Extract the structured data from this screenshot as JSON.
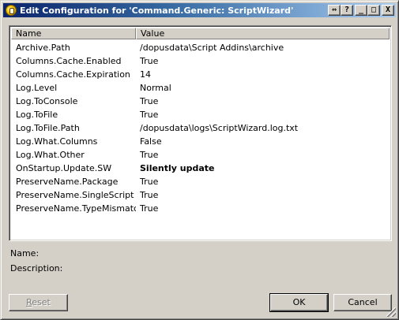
{
  "window": {
    "title": "Edit Configuration for 'Command.Generic: ScriptWizard'",
    "title_buttons": {
      "pin": "⇔",
      "help": "?",
      "minimize": "_",
      "maximize": "□",
      "close": "X"
    }
  },
  "list": {
    "columns": [
      "Name",
      "Value"
    ],
    "rows": [
      {
        "name": "Archive.Path",
        "value": "/dopusdata\\Script Addins\\archive"
      },
      {
        "name": "Columns.Cache.Enabled",
        "value": "True"
      },
      {
        "name": "Columns.Cache.Expiration",
        "value": "14"
      },
      {
        "name": "Log.Level",
        "value": "Normal"
      },
      {
        "name": "Log.ToConsole",
        "value": "True"
      },
      {
        "name": "Log.ToFile",
        "value": "True"
      },
      {
        "name": "Log.ToFile.Path",
        "value": "/dopusdata\\logs\\ScriptWizard.log.txt"
      },
      {
        "name": "Log.What.Columns",
        "value": "False"
      },
      {
        "name": "Log.What.Other",
        "value": "True"
      },
      {
        "name": "OnStartup.Update.SW",
        "value": "Silently update"
      },
      {
        "name": "PreserveName.Package",
        "value": "True"
      },
      {
        "name": "PreserveName.SingleScript",
        "value": "True"
      },
      {
        "name": "PreserveName.TypeMismatch",
        "value": "True"
      }
    ]
  },
  "details": {
    "name_label": "Name:",
    "description_label": "Description:"
  },
  "buttons": {
    "reset": {
      "first": "R",
      "rest": "eset"
    },
    "ok": "OK",
    "cancel": "Cancel"
  }
}
